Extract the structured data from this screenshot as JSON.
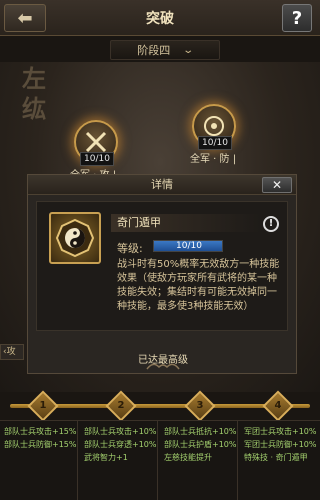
{
  "header": {
    "title": "突破",
    "back_icon": "back-arrow-icon",
    "help_label": "?"
  },
  "stage_select": {
    "value": "阶段四"
  },
  "background": {
    "calligraphy": [
      "左",
      "纮"
    ]
  },
  "nodes": [
    {
      "count": "10/10",
      "label": "全军 · 攻 |",
      "icon": "crossed-swords-icon"
    },
    {
      "count": "10/10",
      "label": "全军 · 防 |",
      "icon": "shield-emblem-icon"
    }
  ],
  "dialog": {
    "title": "详情",
    "close_label": "✕",
    "skill": {
      "name": "奇门遁甲",
      "icon": "yin-yang-bagua-icon",
      "level_label": "等级:",
      "level_value": "10/10",
      "level_fraction": 1.0,
      "description": "战斗时有50%概率无效敌方一种技能效果（使敌方玩家所有武将的某一种技能失效；集结时有可能无效掉同一种技能，最多使3种技能无效）"
    },
    "max_level_text": "已达最高级"
  },
  "side_tab": {
    "label": "攻"
  },
  "track": {
    "steps": [
      "1",
      "2",
      "3",
      "4"
    ]
  },
  "stats": [
    {
      "lines": [
        "部队士兵攻击+15%",
        "部队士兵防御+15%"
      ]
    },
    {
      "lines": [
        "部队士兵攻击+10%",
        "部队士兵穿透+10%",
        "武将智力+1"
      ]
    },
    {
      "lines": [
        "部队士兵抵抗+10%",
        "部队士兵护盾+10%",
        "左慈技能提升"
      ]
    },
    {
      "lines": [
        "军团士兵攻击+10%",
        "军团士兵防御+10%",
        "特殊技 · 奇门遁甲"
      ]
    }
  ],
  "colors": {
    "accent_gold": "#c79a3a",
    "stat_green": "#a3d06e",
    "level_blue": "#3b78c4"
  }
}
